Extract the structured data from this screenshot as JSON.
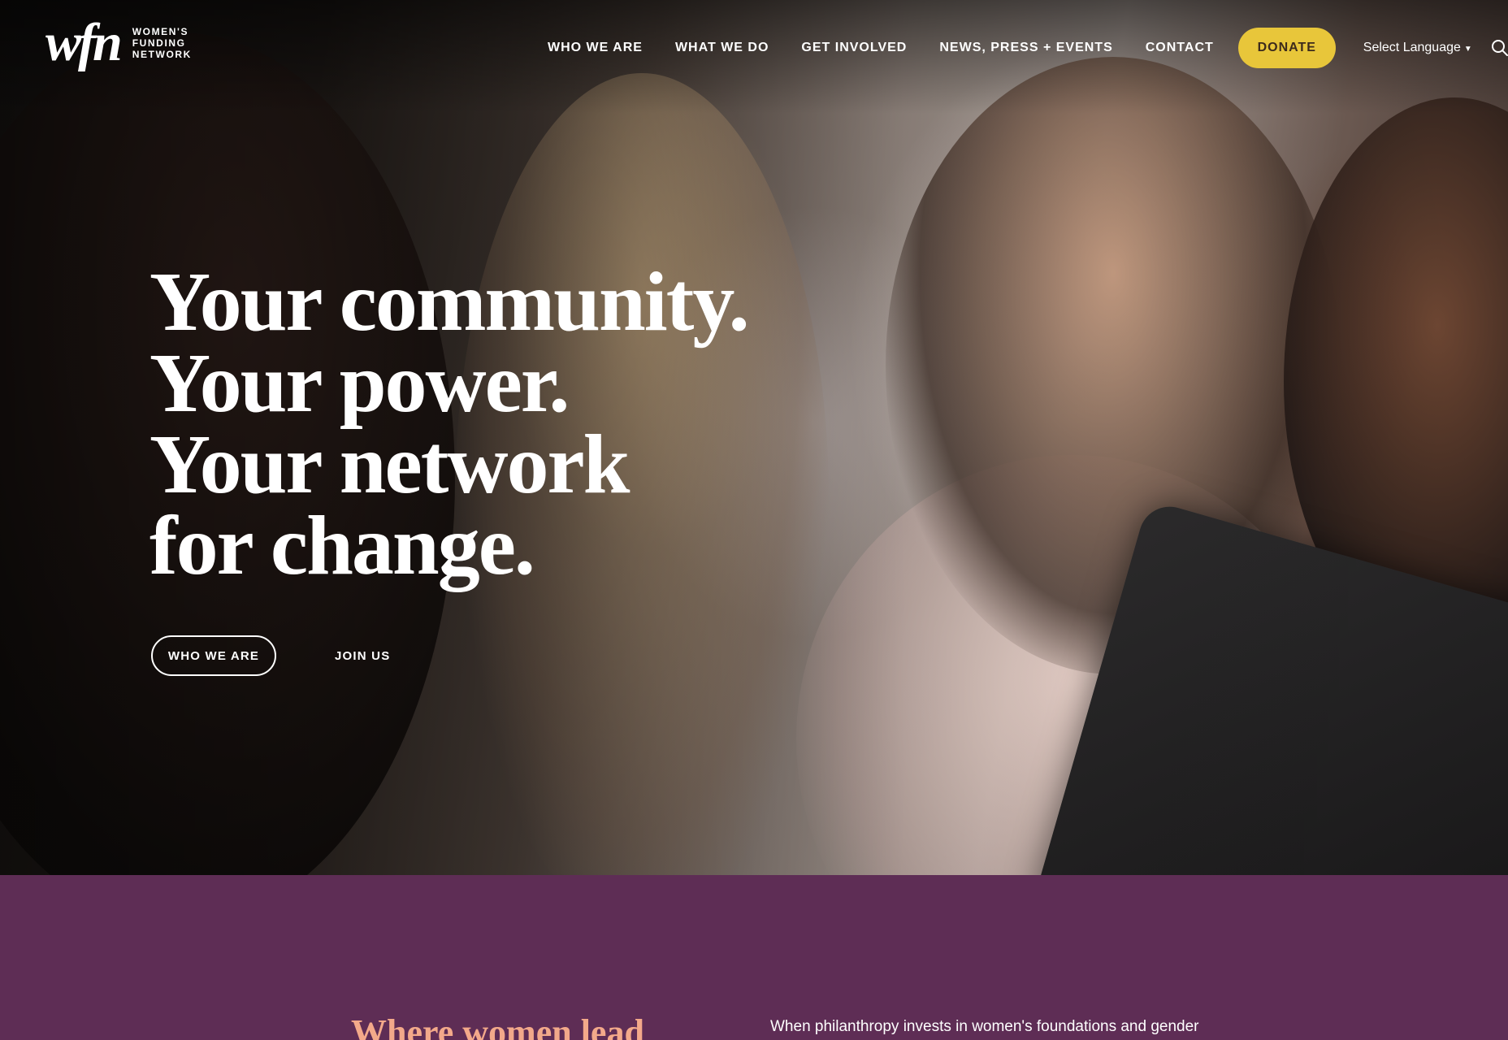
{
  "header": {
    "logo_mark": "wfn",
    "logo_lines": [
      "WOMEN'S",
      "FUNDING",
      "NETWORK"
    ],
    "nav": [
      "WHO WE ARE",
      "WHAT WE DO",
      "GET INVOLVED",
      "NEWS, PRESS + EVENTS",
      "CONTACT"
    ],
    "donate_label": "DONATE",
    "language_label": "Select Language"
  },
  "hero": {
    "headline": [
      "Your community.",
      "Your power.",
      "Your network",
      "for change."
    ],
    "primary_cta": "WHO WE ARE",
    "secondary_cta": "JOIN US"
  },
  "intro": {
    "heading": "Where women lead",
    "body": "When philanthropy invests in women's foundations and gender"
  },
  "colors": {
    "donate_bg": "#e8c63a",
    "section_bg": "#5e2d55",
    "heading_accent": "#f3a98a"
  },
  "icons": {
    "search": "magnifier-icon",
    "language_dropdown": "chevron-down-icon"
  }
}
